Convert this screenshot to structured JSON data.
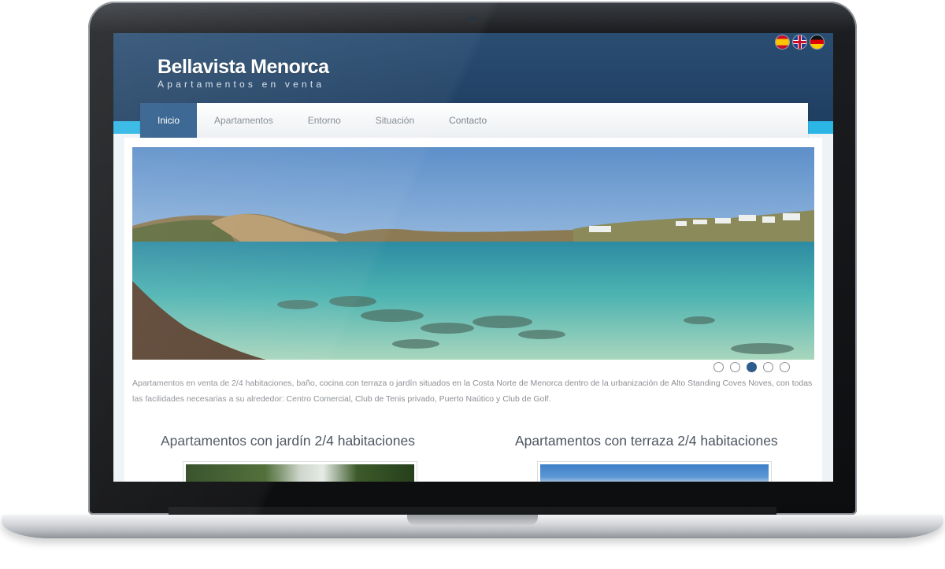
{
  "site": {
    "title": "Bellavista Menorca",
    "subtitle": "Apartamentos en venta"
  },
  "languages": [
    "es-flag-icon",
    "uk-flag-icon",
    "de-flag-icon"
  ],
  "nav": {
    "items": [
      {
        "label": "Inicio",
        "active": true
      },
      {
        "label": "Apartamentos",
        "active": false
      },
      {
        "label": "Entorno",
        "active": false
      },
      {
        "label": "Situación",
        "active": false
      },
      {
        "label": "Contacto",
        "active": false
      }
    ]
  },
  "slider": {
    "total_slides": 5,
    "active_index": 3
  },
  "intro": {
    "text": "Apartamentos en venta de 2/4 habitaciones, baño, cocina con terraza o jardín situados en la Costa Norte de Menorca dentro de la urbanización de Alto Standing Coves Noves, con todas las facilidades necesarias a su alrededor: Centro Comercial, Club de Tenis privado, Puerto Naútico y Club de Golf."
  },
  "sections": [
    {
      "title": "Apartamentos con jardín 2/4 habitaciones"
    },
    {
      "title": "Apartamentos con terraza 2/4 habitaciones"
    }
  ],
  "colors": {
    "header": "#1f3f61",
    "accent_cyan": "#2cb6e6",
    "nav_active": "#2e5c8c",
    "body_text": "#8b8f94"
  }
}
